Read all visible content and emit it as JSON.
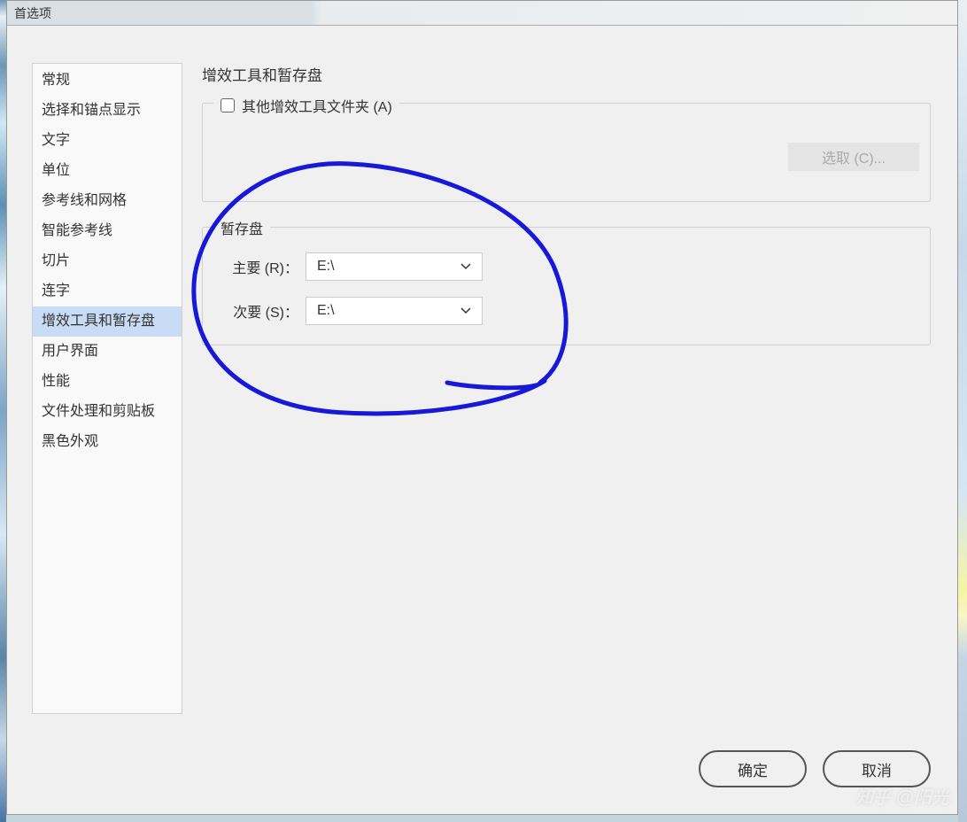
{
  "window": {
    "title": "首选项"
  },
  "sidebar": {
    "items": [
      {
        "label": "常规"
      },
      {
        "label": "选择和锚点显示"
      },
      {
        "label": "文字"
      },
      {
        "label": "单位"
      },
      {
        "label": "参考线和网格"
      },
      {
        "label": "智能参考线"
      },
      {
        "label": "切片"
      },
      {
        "label": "连字"
      },
      {
        "label": "增效工具和暂存盘"
      },
      {
        "label": "用户界面"
      },
      {
        "label": "性能"
      },
      {
        "label": "文件处理和剪贴板"
      },
      {
        "label": "黑色外观"
      }
    ],
    "selected_index": 8
  },
  "main": {
    "title": "增效工具和暂存盘",
    "plugin_folder": {
      "checkbox_label": "其他增效工具文件夹 (A)",
      "checked": false,
      "select_button": "选取 (C)..."
    },
    "scratch_disk": {
      "legend": "暂存盘",
      "primary_label": "主要 (R)：",
      "primary_value": "E:\\",
      "secondary_label": "次要 (S)：",
      "secondary_value": "E:\\"
    }
  },
  "buttons": {
    "ok": "确定",
    "cancel": "取消"
  },
  "watermark": "知乎 @阳光"
}
